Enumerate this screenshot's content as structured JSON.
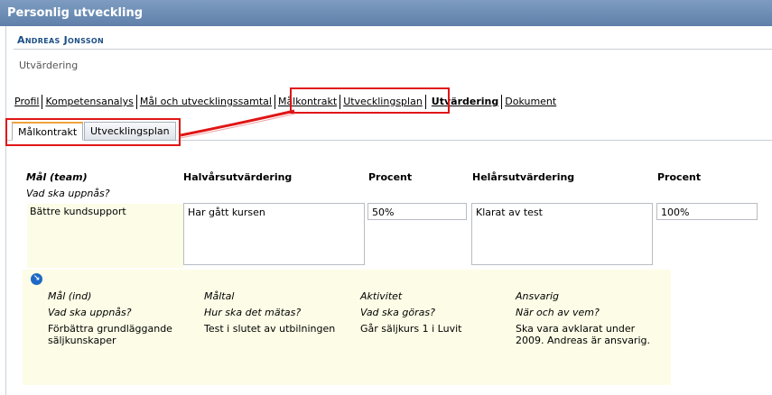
{
  "window": {
    "title": "Personlig utveckling"
  },
  "person": {
    "name": "Andreas Jonsson"
  },
  "section": {
    "label": "Utvärdering"
  },
  "tabs": [
    {
      "label": "Profil"
    },
    {
      "label": "Kompetensanalys"
    },
    {
      "label": "Mål och utvecklingssamtal"
    },
    {
      "label": "Målkontrakt"
    },
    {
      "label": "Utvecklingsplan"
    },
    {
      "label": "Utvärdering",
      "active": true
    },
    {
      "label": "Dokument"
    }
  ],
  "subtabs": [
    {
      "label": "Målkontrakt",
      "active": true
    },
    {
      "label": "Utvecklingsplan"
    }
  ],
  "columns": {
    "goal_team": "Mål (team)",
    "goal_team_question": "Vad ska uppnås?",
    "half_year": "Halvårsutvärdering",
    "percent1": "Procent",
    "full_year": "Helårsutvärdering",
    "percent2": "Procent"
  },
  "row": {
    "goal": "Bättre kundsupport",
    "half_year_value": "Har gått kursen",
    "percent1_value": "50%",
    "full_year_value": "Klarat av test",
    "percent2_value": "100%"
  },
  "individual": {
    "icon": "arrow-down-right-icon",
    "columns": [
      {
        "head": "Mål (ind)",
        "question": "Vad ska uppnås?",
        "value": "Förbättra grundläggande säljkunskaper"
      },
      {
        "head": "Måltal",
        "question": "Hur ska det mätas?",
        "value": "Test i slutet av utbilningen"
      },
      {
        "head": "Aktivitet",
        "question": "Vad ska göras?",
        "value": "Går säljkurs 1 i Luvit"
      },
      {
        "head": "Ansvarig",
        "question": "När och av vem?",
        "value": "Ska vara avklarat under 2009. Andreas är ansvarig."
      }
    ]
  },
  "colors": {
    "titlebar": "#6b8bb4",
    "name": "#1c4f85",
    "highlight": "#e01616",
    "goal_bg": "#fdfde7",
    "icon": "#1e69c5"
  }
}
